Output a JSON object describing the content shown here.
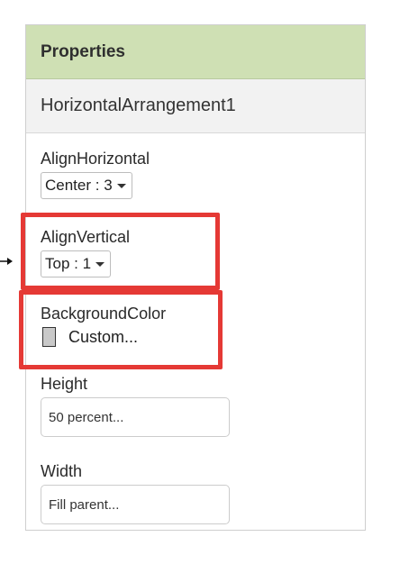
{
  "panel": {
    "title": "Properties",
    "component_name": "HorizontalArrangement1"
  },
  "properties": {
    "align_horizontal": {
      "label": "AlignHorizontal",
      "value": "Center : 3"
    },
    "align_vertical": {
      "label": "AlignVertical",
      "value": "Top : 1"
    },
    "background_color": {
      "label": "BackgroundColor",
      "value": "Custom...",
      "swatch_color": "#c9c9c9"
    },
    "height": {
      "label": "Height",
      "value": "50 percent..."
    },
    "width": {
      "label": "Width",
      "value": "Fill parent..."
    }
  },
  "colors": {
    "header_bg": "#cfe0b4",
    "highlight": "#e53935"
  },
  "icons": {
    "dropdown": "chevron-down-icon",
    "pointer": "arrow-right-icon"
  }
}
